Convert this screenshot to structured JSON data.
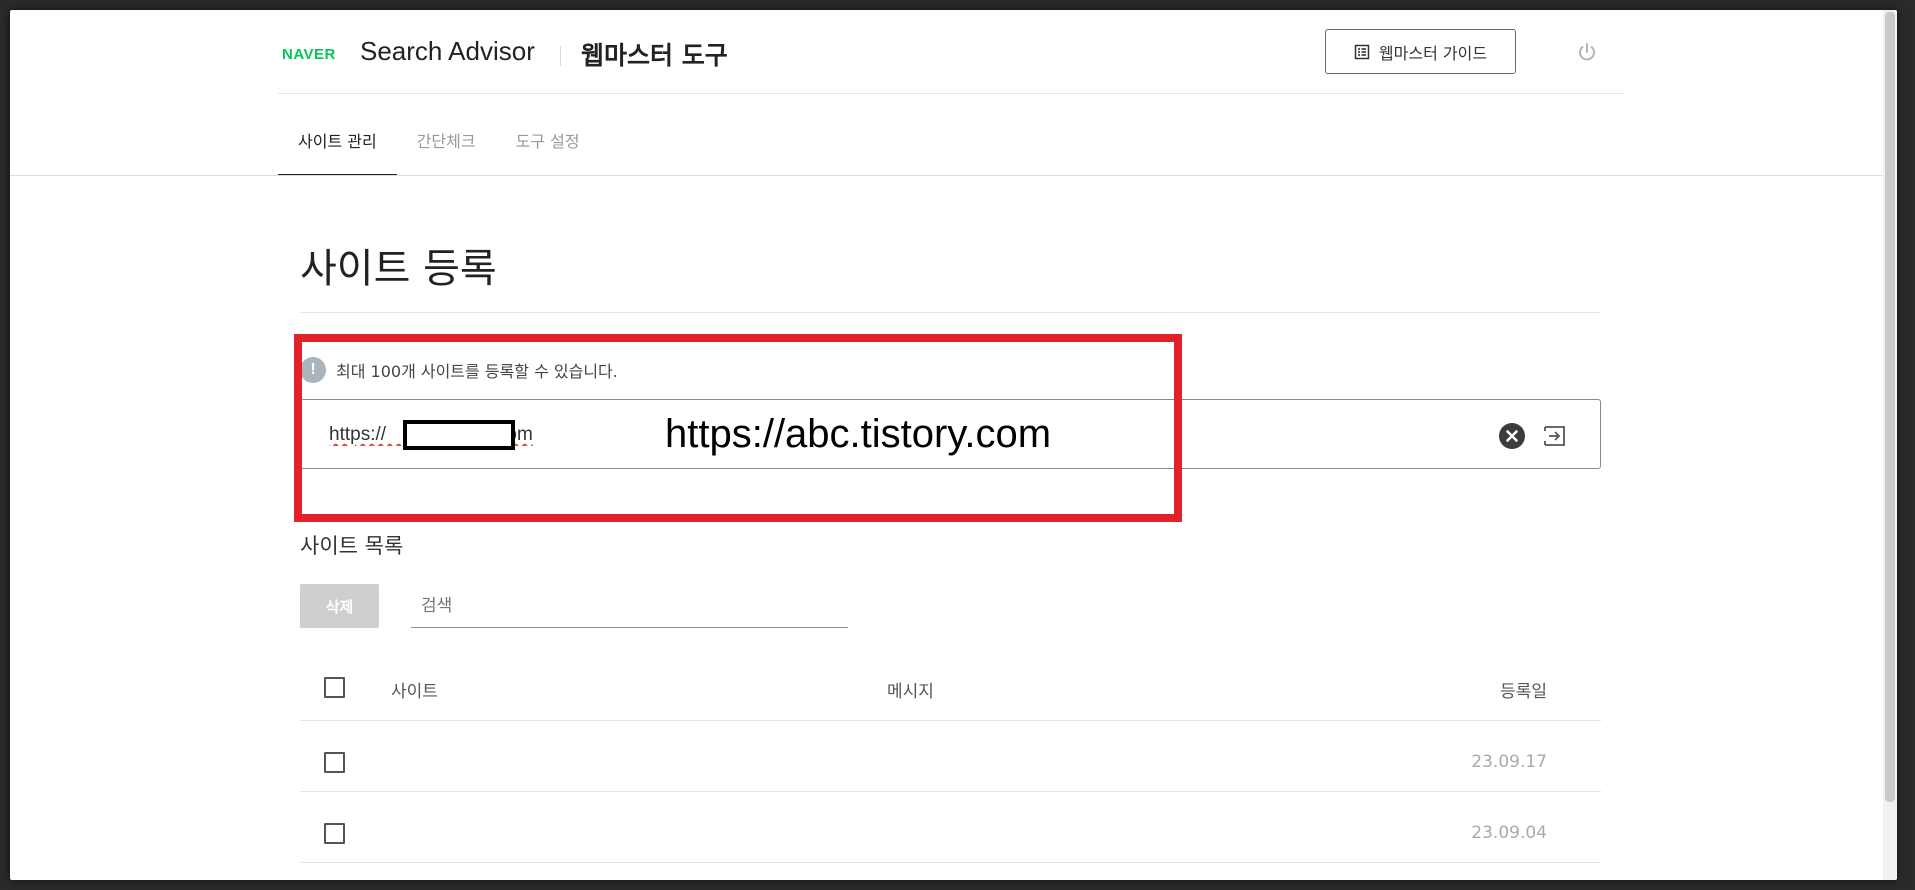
{
  "header": {
    "logo": "NAVER",
    "product": "Search Advisor",
    "tool": "웹마스터 도구",
    "guide_label": "웹마스터 가이드"
  },
  "tabs": [
    {
      "label": "사이트 관리",
      "active": true
    },
    {
      "label": "간단체크",
      "active": false
    },
    {
      "label": "도구 설정",
      "active": false
    }
  ],
  "main": {
    "title": "사이트 등록",
    "notice": "최대 100개 사이트를 등록할 수 있습니다.",
    "url_value": "https://                    .com",
    "url_overlay": "https://abc.tistory.com",
    "section_title": "사이트 목록",
    "delete_label": "삭제",
    "search_placeholder": "검색"
  },
  "table": {
    "columns": [
      "사이트",
      "메시지",
      "등록일"
    ],
    "rows": [
      {
        "site": "",
        "message": "",
        "date": "23.09.17"
      },
      {
        "site": "",
        "message": "",
        "date": "23.09.04"
      }
    ]
  },
  "colors": {
    "brand": "#03c75a",
    "highlight": "#e22228",
    "info": "#a9b4bd"
  },
  "icons": {
    "guide": "book-list-icon",
    "power": "power-icon",
    "info": "info-icon",
    "clear": "close-circle-icon",
    "submit": "enter-arrow-icon"
  }
}
